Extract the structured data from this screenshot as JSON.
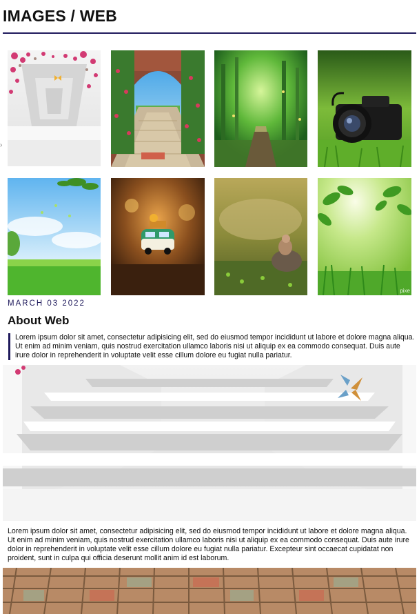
{
  "header": {
    "title": "IMAGES / WEB"
  },
  "gallery": {
    "images": [
      {
        "name": "flower-arch-corridor"
      },
      {
        "name": "brick-path-garden-gate"
      },
      {
        "name": "green-forest-path"
      },
      {
        "name": "camera-on-grass"
      },
      {
        "name": "sky-and-meadow"
      },
      {
        "name": "toy-van-autumn"
      },
      {
        "name": "figurine-on-moss"
      },
      {
        "name": "leaves-and-grass-bokeh"
      }
    ],
    "watermark": "pixe"
  },
  "post": {
    "date": "MARCH 03 2022",
    "heading": "About Web",
    "quote": "Lorem ipsum dolor sit amet, consectetur adipisicing elit, sed do eiusmod tempor incididunt ut labore et dolore magna aliqua. Ut enim ad minim veniam, quis nostrud exercitation ullamco laboris nisi ut aliquip ex ea commodo consequat. Duis aute irure dolor in reprehenderit in voluptate velit esse cillum dolore eu fugiat nulla pariatur.",
    "body": "Lorem ipsum dolor sit amet, consectetur adipisicing elit, sed do eiusmod tempor incididunt ut labore et dolore magna aliqua. Ut enim ad minim veniam, quis nostrud exercitation ullamco laboris nisi ut aliquip ex ea commodo consequat. Duis aute irure dolor in reprehenderit in voluptate velit esse cillum dolore eu fugiat nulla pariatur. Excepteur sint occaecat cupidatat non proident, sunt in culpa qui officia deserunt mollit anim id est laborum."
  },
  "colors": {
    "accent": "#1f1a5c",
    "text": "#111111",
    "background": "#ffffff"
  }
}
